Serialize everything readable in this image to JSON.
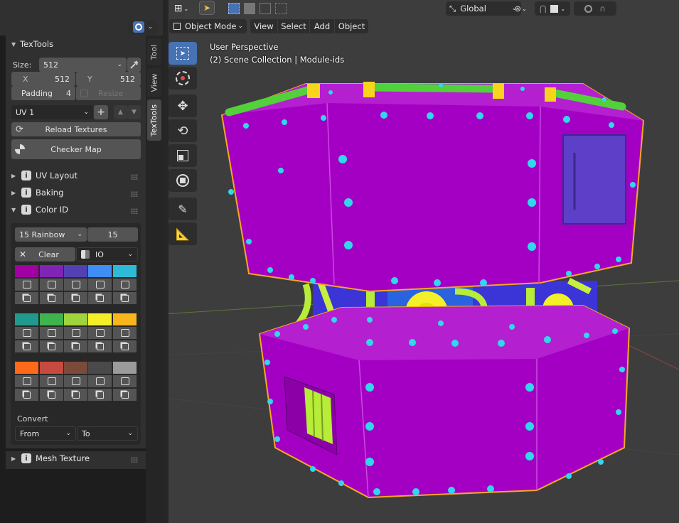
{
  "sidebar": {
    "tabs": [
      "Tool",
      "View",
      "TexTools"
    ],
    "texttools_title": "TexTools",
    "size": {
      "label": "Size:",
      "value": "512"
    },
    "x": {
      "label": "X",
      "value": "512"
    },
    "y": {
      "label": "Y",
      "value": "512"
    },
    "padding": {
      "label": "Padding",
      "value": "4"
    },
    "resize_label": "Resize",
    "uv_map": "UV 1",
    "reload_textures": "Reload Textures",
    "checker_map": "Checker Map",
    "panels": {
      "uv_layout": "UV Layout",
      "baking": "Baking",
      "color_id": "Color ID",
      "mesh_texture": "Mesh Texture"
    },
    "color_id": {
      "palette": "15 Rainbow",
      "count": "15",
      "clear": "Clear",
      "mode": "IO",
      "colors": [
        [
          "#a100a3",
          "#7f24b4",
          "#5241b4",
          "#3e8ef5",
          "#2eb9d6"
        ],
        [
          "#1f9a8c",
          "#3fb34d",
          "#9fd43c",
          "#f3f02a",
          "#f8b51c"
        ],
        [
          "#ff6a1a",
          "#c64a3e",
          "#7b4a3a",
          "#4a4a4a",
          "#9b9b9b"
        ]
      ],
      "convert_label": "Convert",
      "from": "From",
      "to": "To"
    }
  },
  "viewport": {
    "mode": "Object Mode",
    "menus": [
      "View",
      "Select",
      "Add",
      "Object"
    ],
    "orientation": "Global",
    "perspective": "User Perspective",
    "collection": "(2) Scene Collection | Module-ids"
  },
  "colors": {
    "accent": "#4772b3",
    "object_purple": "#a400c4",
    "rivet_cyan": "#2fd8ea",
    "pipe_green": "#53d13b",
    "selection_orange": "#f5a623"
  }
}
